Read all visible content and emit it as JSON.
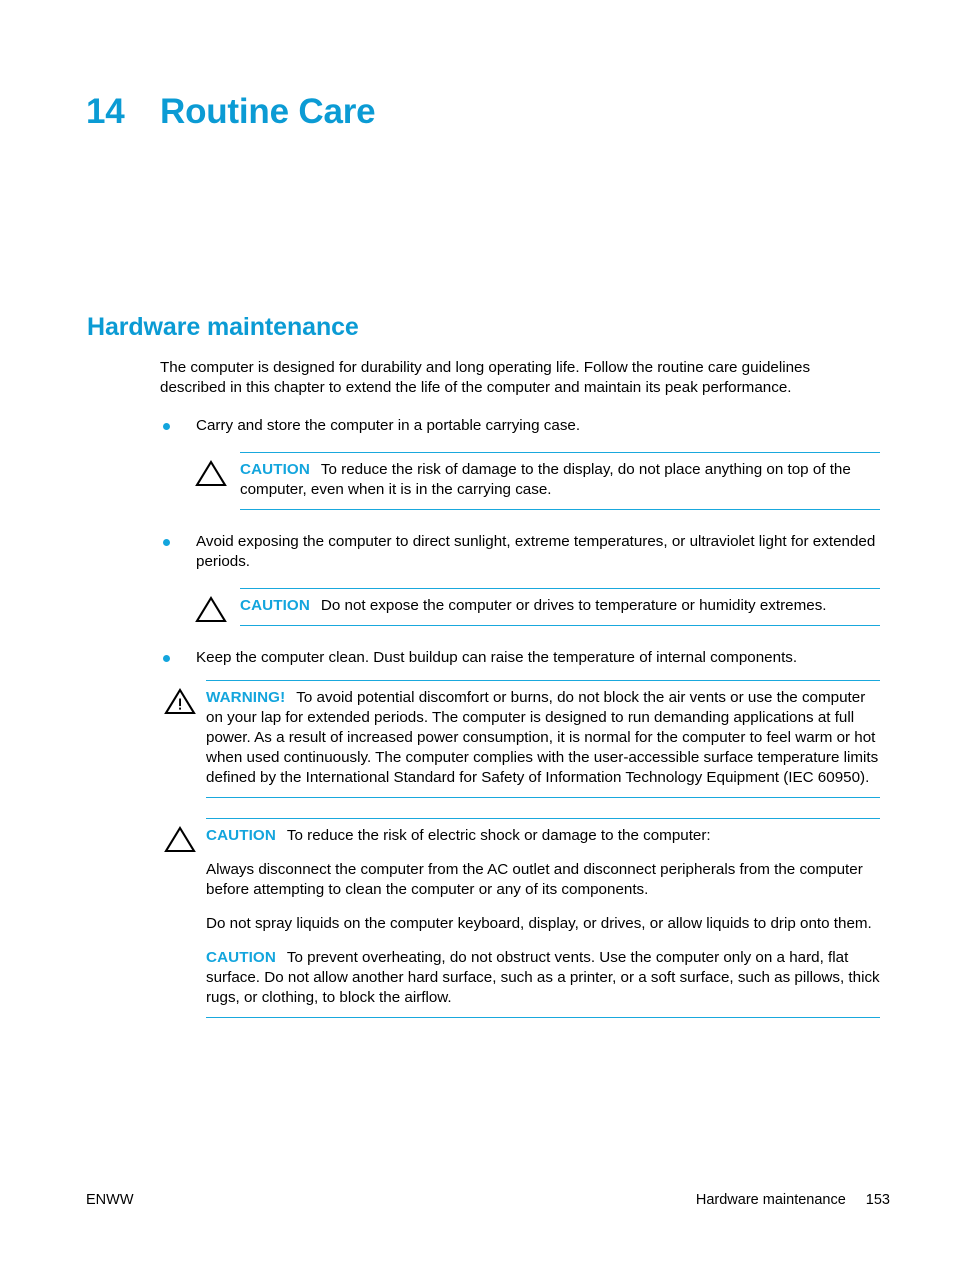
{
  "page": {
    "chapter_number": "14",
    "chapter_title": "Routine Care",
    "section_heading": "Hardware maintenance",
    "accent_color": "#0b9bd4",
    "rule_color": "#19a8dd"
  },
  "intro": "The computer is designed for durability and long operating life. Follow the routine care guidelines described in this chapter to extend the life of the computer and maintain its peak performance.",
  "bullets": {
    "b1": "Carry and store the computer in a portable carrying case.",
    "b2": "Avoid exposing the computer to direct sunlight, extreme temperatures, or ultraviolet light for extended periods.",
    "b3": "Keep the computer clean. Dust buildup can raise the temperature of internal components."
  },
  "admonitions": {
    "caution1": {
      "label": "CAUTION",
      "icon": "caution-triangle-icon",
      "text": "To reduce the risk of damage to the display, do not place anything on top of the computer, even when it is in the carrying case."
    },
    "caution2": {
      "label": "CAUTION",
      "icon": "caution-triangle-icon",
      "text": "Do not expose the computer or drives to temperature or humidity extremes."
    },
    "warning1": {
      "label": "WARNING!",
      "icon": "warning-triangle-exclamation-icon",
      "text": "To avoid potential discomfort or burns, do not block the air vents or use the computer on your lap for extended periods. The computer is designed to run demanding applications at full power. As a result of increased power consumption, it is normal for the computer to feel warm or hot when used continuously. The computer complies with the user-accessible surface temperature limits defined by the International Standard for Safety of Information Technology Equipment (IEC 60950)."
    },
    "caution3": {
      "label": "CAUTION",
      "icon": "caution-triangle-icon",
      "lead": "To reduce the risk of electric shock or damage to the computer:",
      "para1": "Always disconnect the computer from the AC outlet and disconnect peripherals from the computer before attempting to clean the computer or any of its components.",
      "para2": "Do not spray liquids on the computer keyboard, display, or drives, or allow liquids to drip onto them.",
      "inline_label": "CAUTION",
      "para3": "To prevent overheating, do not obstruct vents. Use the computer only on a hard, flat surface. Do not allow another hard surface, such as a printer, or a soft surface, such as pillows, thick rugs, or clothing, to block the airflow."
    }
  },
  "footer": {
    "left": "ENWW",
    "section": "Hardware maintenance",
    "page_number": "153"
  }
}
